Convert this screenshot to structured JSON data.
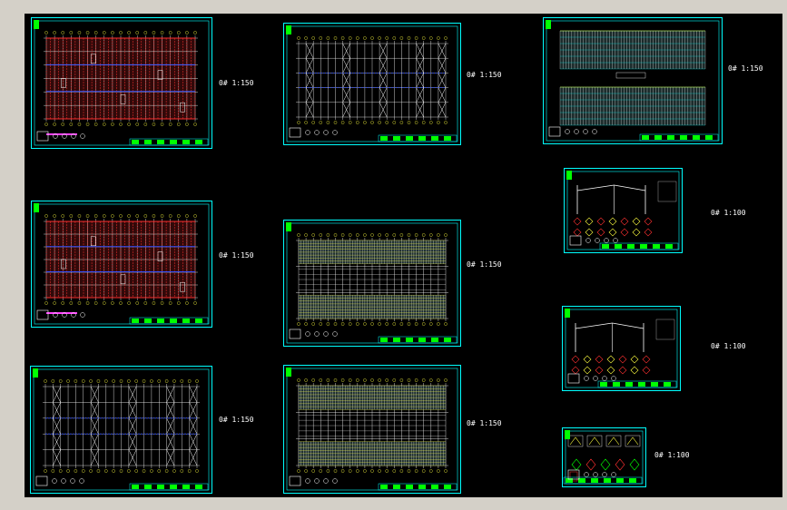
{
  "viewer": {
    "background": "#000000",
    "frame": "#d4d0c8"
  },
  "colors": {
    "frame": "#00ffff",
    "grid": "#ffffff",
    "red": "#ff3030",
    "blue": "#3050ff",
    "green": "#00ff00",
    "yellow": "#ffff40",
    "brown": "#5a1010"
  },
  "sheets": [
    {
      "id": "s1",
      "kind": "plan-red",
      "scale": "0# 1:150"
    },
    {
      "id": "s2",
      "kind": "plan-red",
      "scale": "0# 1:150"
    },
    {
      "id": "s3",
      "kind": "bracing",
      "scale": "0# 1:150"
    },
    {
      "id": "s4",
      "kind": "bracing",
      "scale": "0# 1:150"
    },
    {
      "id": "s5",
      "kind": "roof",
      "scale": "0# 1:150"
    },
    {
      "id": "s6",
      "kind": "roof",
      "scale": "0# 1:150"
    },
    {
      "id": "s7",
      "kind": "elevation",
      "scale": "0# 1:150"
    },
    {
      "id": "s8",
      "kind": "detail",
      "scale": "0# 1:100"
    },
    {
      "id": "s9",
      "kind": "detail",
      "scale": "0# 1:100"
    },
    {
      "id": "s10",
      "kind": "nodes",
      "scale": "0# 1:100"
    }
  ]
}
